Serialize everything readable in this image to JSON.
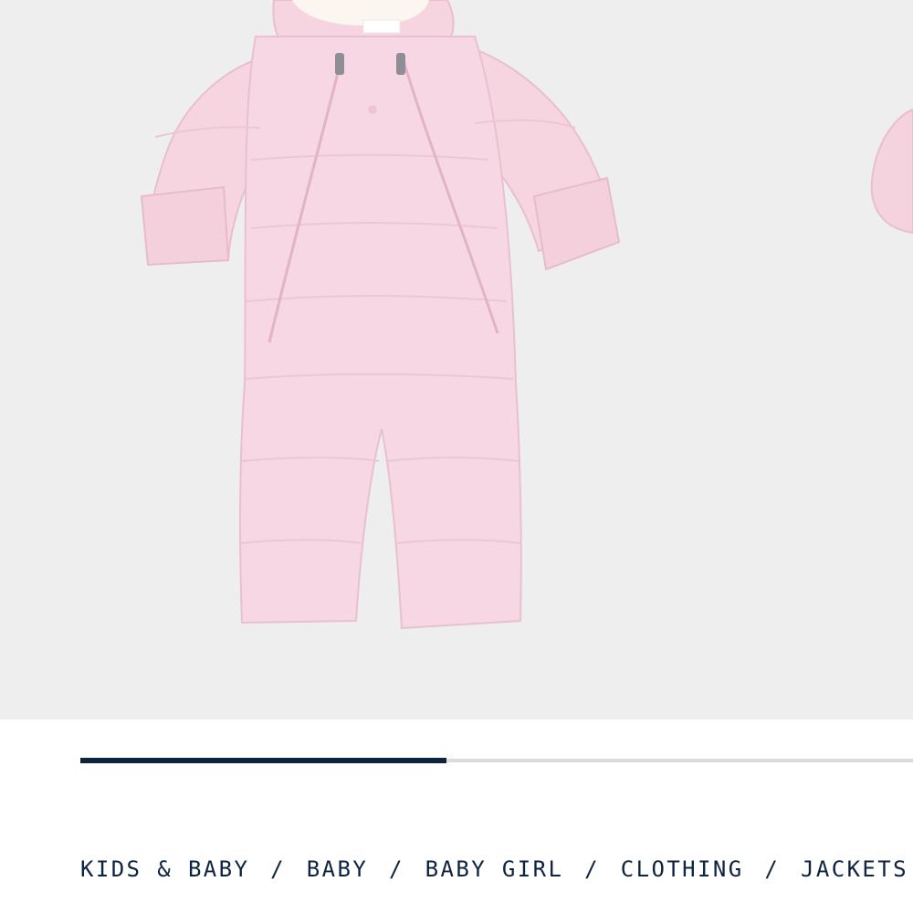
{
  "colors": {
    "background": "#ffffff",
    "gallery_bg": "#efeeee",
    "garment_pink": "#f5d3df",
    "accent_navy": "#0e2340",
    "track_gray": "#dcdbe0",
    "breadcrumb_text": "#0e2340"
  },
  "gallery": {
    "image_alt": "Pink down snowsuit with hood and double front zippers",
    "progress": 0.44
  },
  "breadcrumb": {
    "items": [
      "KIDS & BABY",
      "BABY",
      "BABY GIRL",
      "CLOTHING",
      "JACKETS"
    ],
    "separator": "/"
  }
}
